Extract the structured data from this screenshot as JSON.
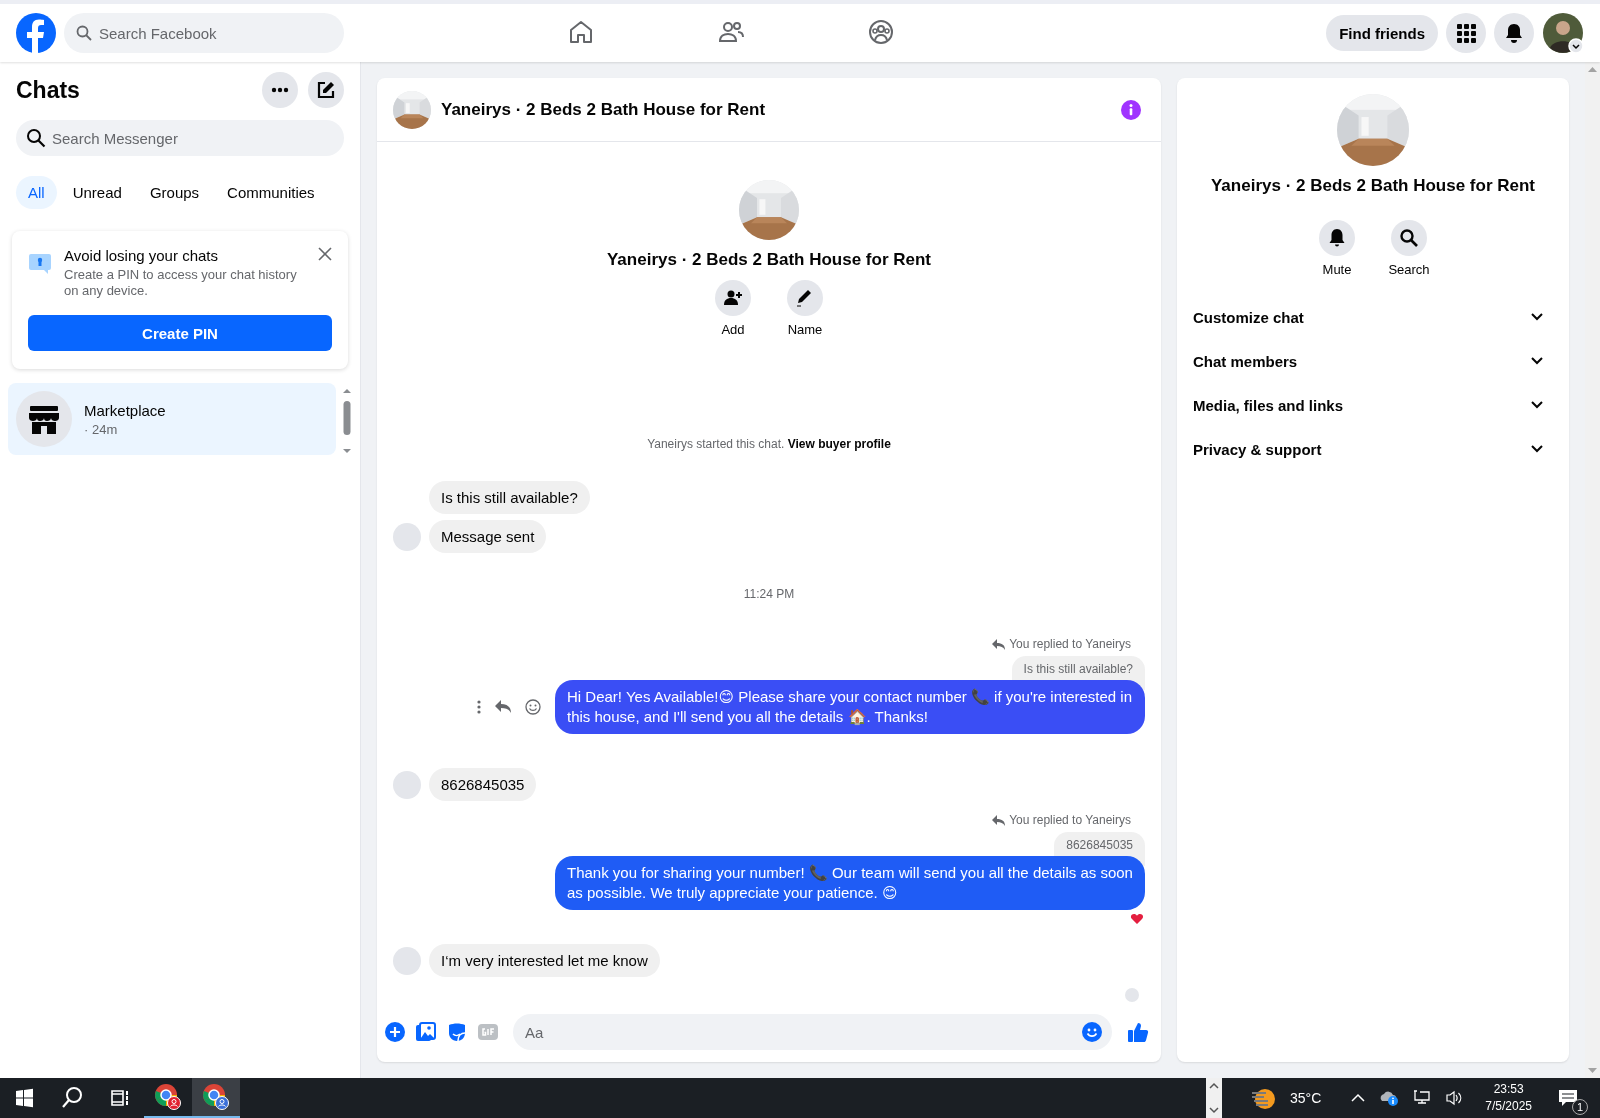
{
  "topbar": {
    "search": {
      "placeholder": "Search Facebook"
    },
    "nav": [
      {
        "kind": "home"
      },
      {
        "kind": "friends"
      },
      {
        "kind": "groups"
      }
    ],
    "find_friends": "Find friends"
  },
  "sidebar": {
    "title": "Chats",
    "search": {
      "placeholder": "Search Messenger"
    },
    "tabs": [
      {
        "label": "All",
        "selected": true
      },
      {
        "label": "Unread",
        "selected": false
      },
      {
        "label": "Groups",
        "selected": false
      },
      {
        "label": "Communities",
        "selected": false
      }
    ],
    "pin_card": {
      "title": "Avoid losing your chats",
      "text": "Create a PIN to access your chat history on any device.",
      "button": "Create PIN"
    },
    "chats": [
      {
        "name": "Marketplace",
        "time": "· 24m",
        "selected": true
      }
    ]
  },
  "chat": {
    "title": "Yaneirys · 2 Beds 2 Bath House for Rent",
    "intro": {
      "title": "Yaneirys · 2 Beds 2 Bath House for Rent",
      "actions": [
        {
          "kind": "add",
          "label": "Add"
        },
        {
          "kind": "name",
          "label": "Name"
        }
      ]
    },
    "messages": [
      {
        "kind": "system",
        "text": "Yaneirys started this chat.",
        "link": "View buyer profile"
      },
      {
        "kind": "incoming",
        "text": "Is this still available?",
        "avatar": false
      },
      {
        "kind": "incoming",
        "text": "Message sent",
        "avatar": true
      },
      {
        "kind": "time",
        "text": "11:24 PM"
      },
      {
        "kind": "outgoing",
        "replied": "You replied to Yaneirys",
        "quote": "Is this still available?",
        "text": "Hi Dear! Yes Available!😊 Please share your contact number 📞 if you're interested in this house, and I'll send you all the details 🏠. Thanks!",
        "hover_actions": true,
        "reaction": false
      },
      {
        "kind": "incoming",
        "text": "8626845035",
        "avatar": true
      },
      {
        "kind": "outgoing",
        "replied": "You replied to Yaneirys",
        "quote": "8626845035",
        "text": "Thank you for sharing your number! 📞 Our team will send you all the details as soon as possible. We truly appreciate your patience. 😊",
        "hover_actions": false,
        "reaction": true
      },
      {
        "kind": "incoming",
        "text": "I‘m very interested let me know",
        "avatar": true
      }
    ],
    "composer": {
      "placeholder": "Aa"
    }
  },
  "info_panel": {
    "title": "Yaneirys · 2 Beds 2 Bath House for Rent",
    "actions": [
      {
        "kind": "mute",
        "label": "Mute"
      },
      {
        "kind": "search",
        "label": "Search"
      }
    ],
    "sections": [
      {
        "label": "Customize chat",
        "expanded": false
      },
      {
        "label": "Chat members",
        "expanded": false
      },
      {
        "label": "Media, files and links",
        "expanded": false
      },
      {
        "label": "Privacy & support",
        "expanded": false
      }
    ]
  },
  "taskbar": {
    "apps": [
      {
        "kind": "browser-red",
        "selected": false
      },
      {
        "kind": "browser-blue",
        "selected": true
      }
    ],
    "weather": "35°C",
    "time": "23:53",
    "date": "7/5/2025",
    "notifications": "1"
  }
}
